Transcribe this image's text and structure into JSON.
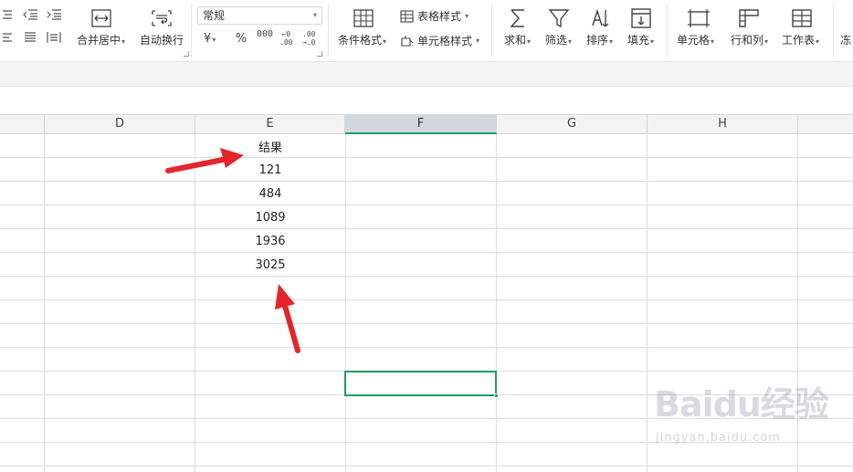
{
  "ribbon": {
    "merge_center": "合并居中",
    "wrap_text": "自动换行",
    "number_format": "常规",
    "currency_symbol": "¥",
    "percent_symbol": "%",
    "thousands_symbol": "000",
    "dec_increase": "←0\n.00",
    "dec_decrease": ".00\n→.0",
    "conditional_format": "条件格式",
    "table_style": "表格样式",
    "cell_style": "单元格样式",
    "sum": "求和",
    "filter": "筛选",
    "sort": "排序",
    "fill": "填充",
    "cells": "单元格",
    "row_col": "行和列",
    "worksheet": "工作表",
    "freeze": "冻"
  },
  "columns": [
    {
      "label": "D"
    },
    {
      "label": "E"
    },
    {
      "label": "F",
      "selected": true
    },
    {
      "label": "G"
    },
    {
      "label": "H"
    }
  ],
  "column_e_values": [
    "结果",
    "121",
    "484",
    "1089",
    "1936",
    "3025"
  ],
  "selected_column": "F",
  "colors": {
    "accent_green": "#1f9e63",
    "arrow_red": "#e3262b"
  },
  "watermark": {
    "logo": "Baidu经验",
    "url": "jingyan.baidu.com"
  }
}
